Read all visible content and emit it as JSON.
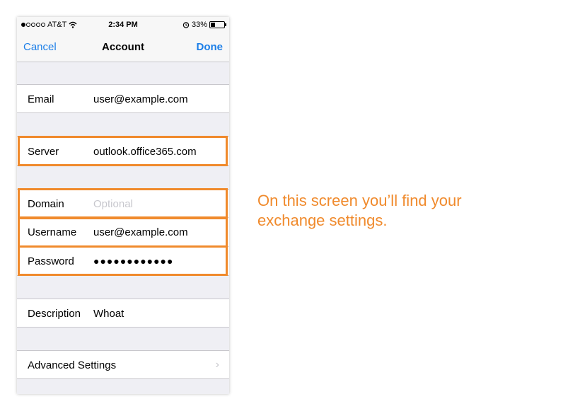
{
  "status_bar": {
    "carrier": "AT&T",
    "time": "2:34 PM",
    "battery": "33%",
    "battery_level": 0.33
  },
  "nav": {
    "cancel": "Cancel",
    "title": "Account",
    "done": "Done"
  },
  "fields": {
    "email": {
      "label": "Email",
      "value": "user@example.com"
    },
    "server": {
      "label": "Server",
      "value": "outlook.office365.com"
    },
    "domain": {
      "label": "Domain",
      "placeholder": "Optional"
    },
    "username": {
      "label": "Username",
      "value": "user@example.com"
    },
    "password": {
      "label": "Password",
      "value": "●●●●●●●●●●●●"
    },
    "description": {
      "label": "Description",
      "value": "Whoat"
    },
    "advanced": {
      "label": "Advanced Settings"
    }
  },
  "caption": {
    "line1": "On this screen you’ll find your",
    "line2": "exchange settings."
  },
  "colors": {
    "accent": "#f08a2c",
    "ios_blue": "#1b7ee8"
  }
}
